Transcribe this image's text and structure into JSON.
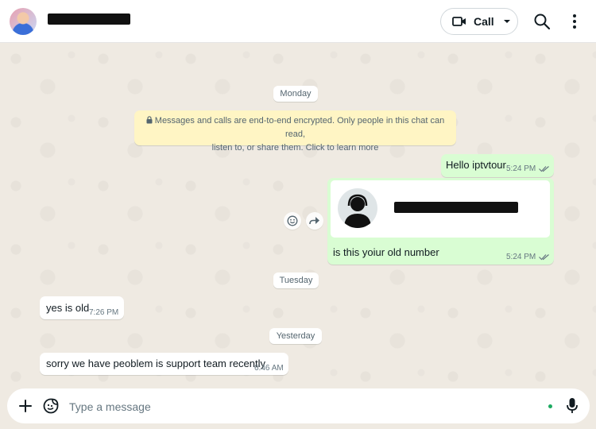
{
  "header": {
    "contact_name": "",
    "call_label": "Call"
  },
  "chat": {
    "day_labels": [
      "Monday",
      "Tuesday",
      "Yesterday"
    ],
    "encryption_notice": {
      "line1": "Messages and calls are end-to-end encrypted. Only people in this chat can read,",
      "line2": "listen to, or share them. Click to learn more"
    },
    "messages": [
      {
        "direction": "outgoing",
        "text": "Hello iptvtour",
        "time": "5:24 PM",
        "status": "read"
      },
      {
        "direction": "outgoing",
        "type": "contact_card",
        "text": "is this yoiur old number",
        "time": "5:24 PM",
        "status": "read"
      },
      {
        "direction": "incoming",
        "text": "yes is old",
        "time": "7:26 PM"
      },
      {
        "direction": "incoming",
        "text": "sorry we have peoblem is support team recently",
        "time": "6:46 AM"
      }
    ]
  },
  "composer": {
    "placeholder": "Type a message"
  },
  "icons": {
    "call": "video-camera-icon",
    "call_caret": "chevron-down-icon",
    "search": "search-icon",
    "menu": "more-vertical-icon",
    "lock": "lock-icon",
    "ticks": "double-check-icon",
    "react": "emoji-icon",
    "forward": "forward-icon",
    "attach": "plus-icon",
    "sticker": "sticker-icon",
    "mic": "microphone-icon"
  },
  "colors": {
    "chat_background": "#efeae2",
    "outgoing_bubble": "#d9fdd3",
    "incoming_bubble": "#ffffff",
    "encryption_banner": "#fff5c4",
    "read_ticks": "#667781",
    "online_dot": "#1daa61"
  }
}
